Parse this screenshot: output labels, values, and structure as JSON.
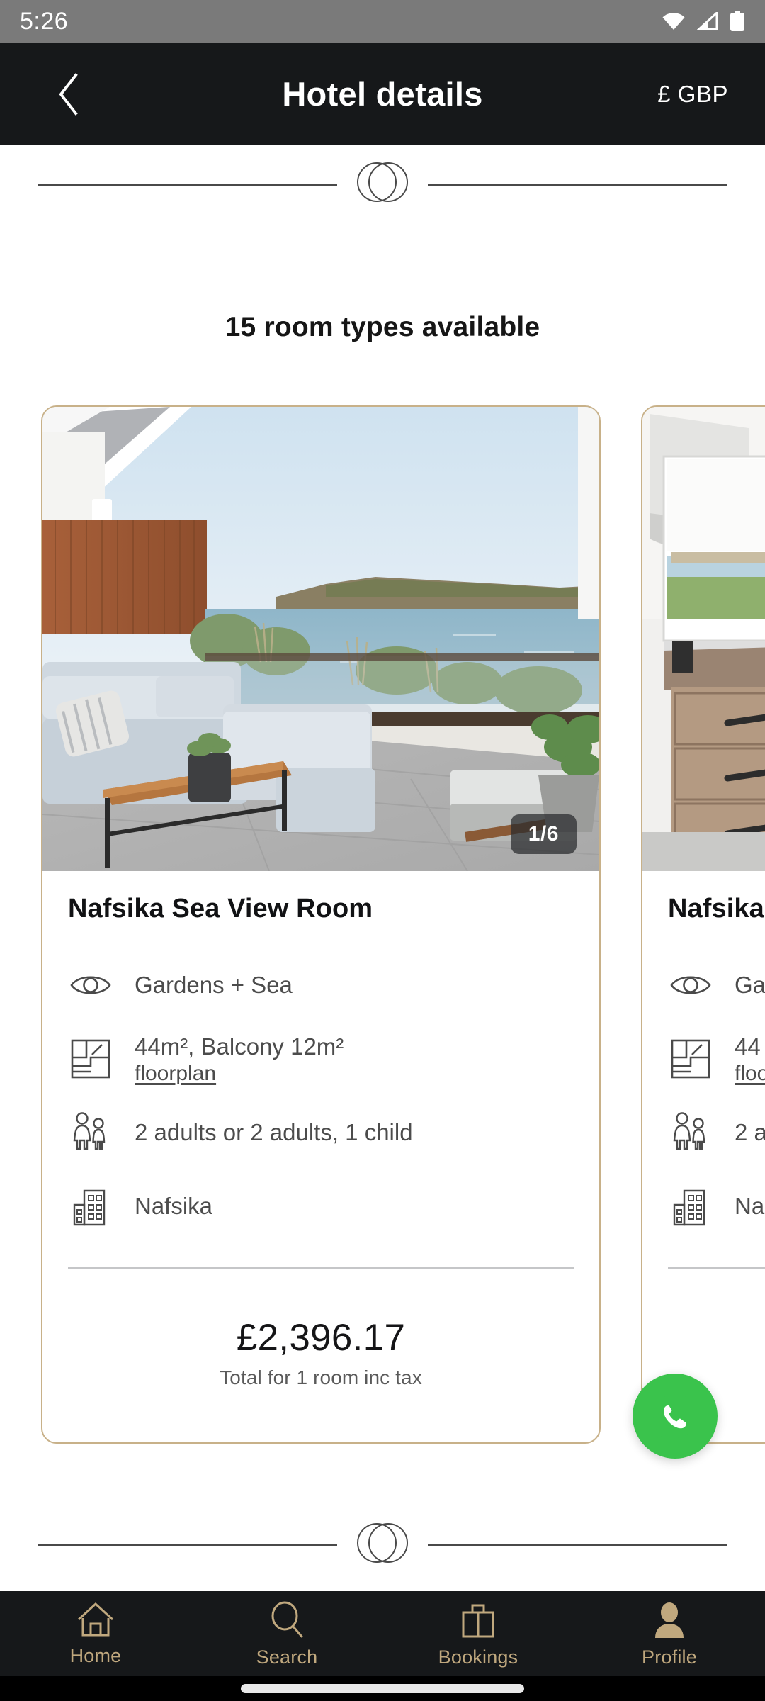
{
  "status_bar": {
    "time": "5:26",
    "icons": [
      "wifi-icon",
      "cellular-signal-icon",
      "battery-icon"
    ]
  },
  "header": {
    "back_icon": "chevron-left-icon",
    "title": "Hotel details",
    "currency": "£ GBP",
    "background_color": "#16181a"
  },
  "divider": {
    "logo_icon": "two-circles-logo"
  },
  "section": {
    "title": "15 room types available"
  },
  "cards": [
    {
      "name": "Nafsika Sea View Room",
      "photo_badge": "1/6",
      "photo_alt": "balcony-terrace-sea-view",
      "attributes": [
        {
          "icon": "eye-icon",
          "text": "Gardens + Sea"
        },
        {
          "icon": "floorplan-icon",
          "text": "44m², Balcony 12m²",
          "link": "floorplan"
        },
        {
          "icon": "occupancy-icon",
          "text": "2 adults or 2 adults, 1 child"
        },
        {
          "icon": "building-icon",
          "text": "Nafsika"
        }
      ],
      "price": "£2,396.17",
      "price_note": "Total for 1 room inc tax"
    },
    {
      "name": "Nafsika S",
      "photo_alt": "kitchen-dresser-window-view",
      "attributes": [
        {
          "icon": "eye-icon",
          "text": "Ga"
        },
        {
          "icon": "floorplan-icon",
          "text": "44",
          "link": "floo"
        },
        {
          "icon": "occupancy-icon",
          "text": "2 a"
        },
        {
          "icon": "building-icon",
          "text": "Na"
        }
      ]
    }
  ],
  "whatsapp_fab": {
    "icon": "whatsapp-icon",
    "color": "#3ac34c"
  },
  "bottom_nav": {
    "accent_color": "#c0a87e",
    "items": [
      {
        "icon": "home-icon",
        "label": "Home"
      },
      {
        "icon": "search-icon",
        "label": "Search"
      },
      {
        "icon": "suitcase-icon",
        "label": "Bookings"
      },
      {
        "icon": "person-icon",
        "label": "Profile"
      }
    ]
  },
  "theme": {
    "card_border": "#c8b189",
    "header_bg": "#16181a",
    "status_bg": "#7a7a7a"
  }
}
